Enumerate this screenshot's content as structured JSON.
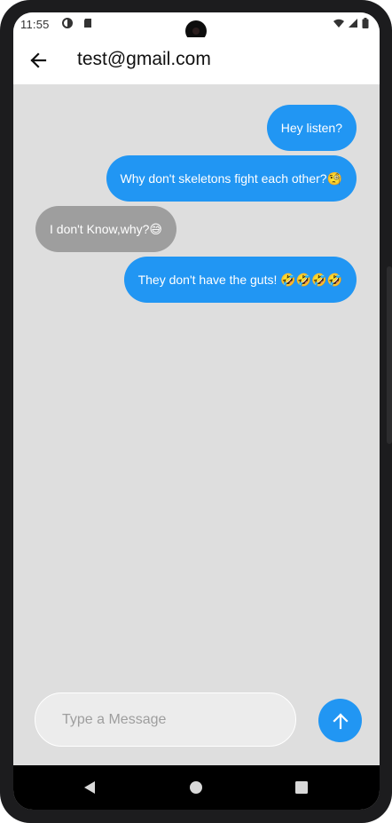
{
  "status_bar": {
    "time": "11:55",
    "icons": [
      "sync-icon",
      "sd-card-icon",
      "wifi-icon",
      "signal-icon",
      "battery-icon"
    ]
  },
  "app_bar": {
    "back_icon": "arrow-back-icon",
    "title": "test@gmail.com"
  },
  "messages": [
    {
      "text": "Hey listen?",
      "sender": "me"
    },
    {
      "text": "Why don't skeletons fight each other?🧐",
      "sender": "me"
    },
    {
      "text": "I don't Know,why?😅",
      "sender": "other"
    },
    {
      "text": "They don't have the guts! 🤣🤣🤣🤣",
      "sender": "me"
    }
  ],
  "composer": {
    "placeholder": "Type a Message",
    "value": "",
    "send_icon": "arrow-up-icon"
  },
  "navigation": {
    "items": [
      "back-triangle-icon",
      "home-circle-icon",
      "recents-square-icon"
    ]
  },
  "colors": {
    "accent": "#2196f3",
    "received_bubble": "#9e9e9e",
    "chat_background": "#dedede"
  }
}
